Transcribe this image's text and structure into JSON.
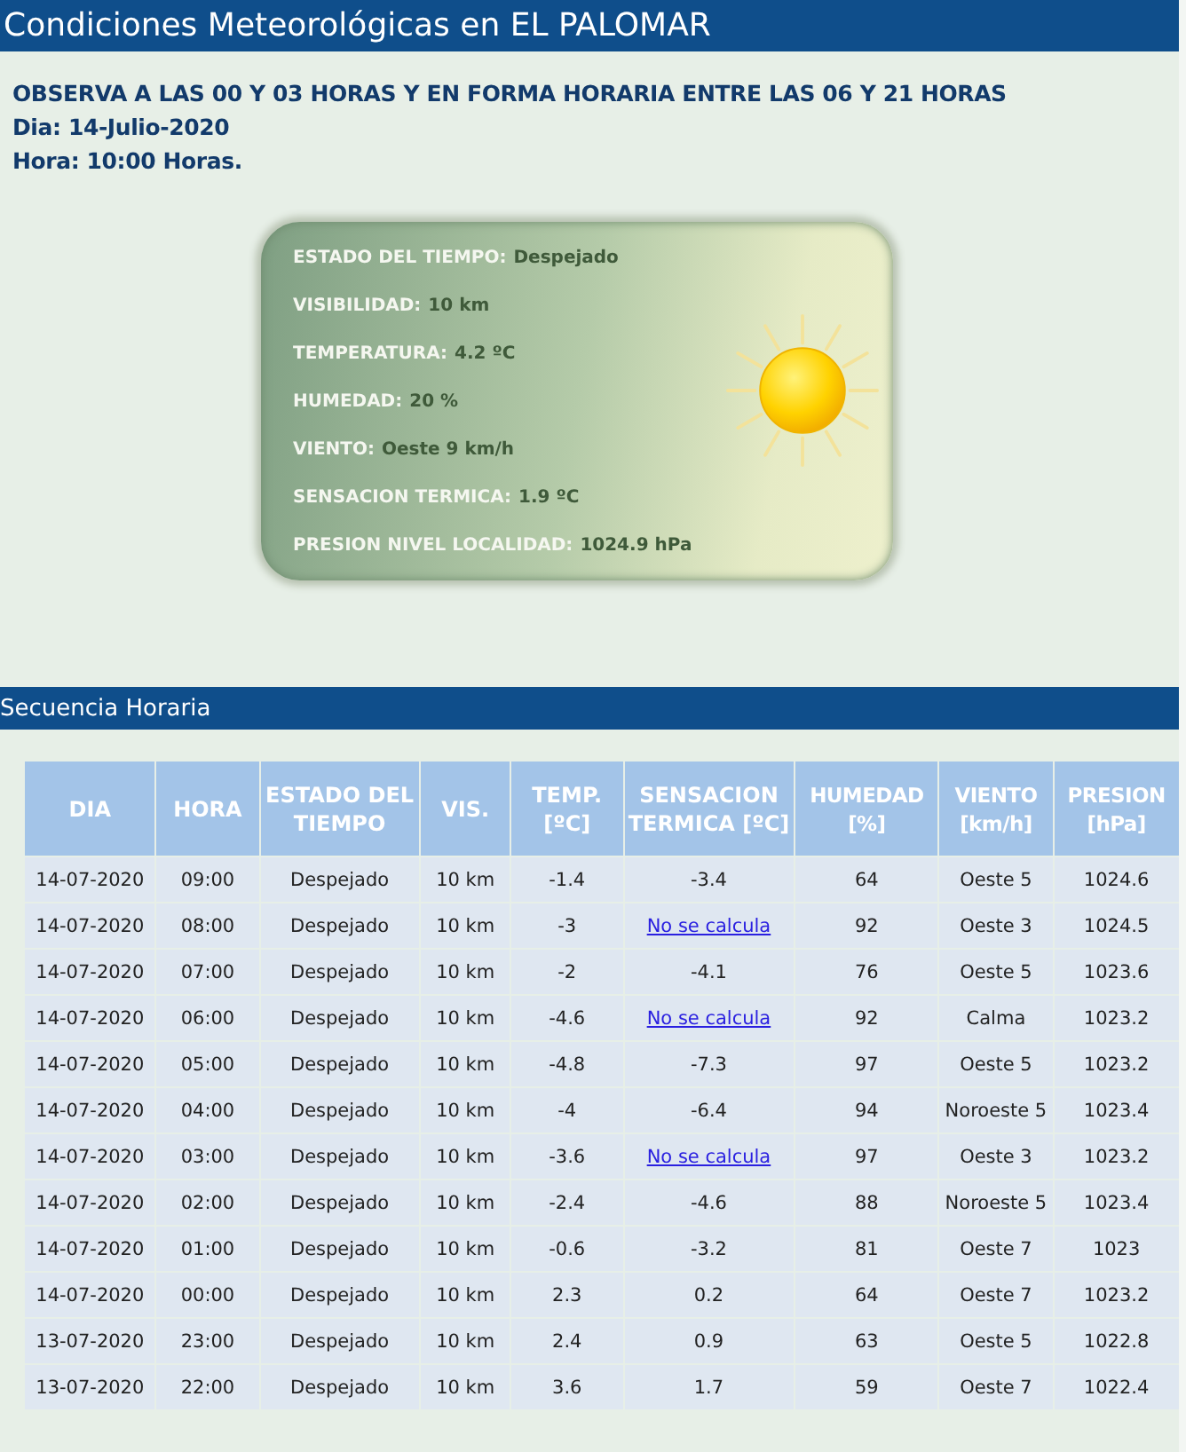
{
  "header": {
    "title": "Condiciones Meteorológicas en EL PALOMAR"
  },
  "info": [
    "OBSERVA A LAS 00 Y 03 HORAS Y EN FORMA HORARIA ENTRE LAS 06 Y 21 HORAS",
    "Dia: 14-Julio-2020",
    "Hora: 10:00 Horas."
  ],
  "current": {
    "fields": [
      {
        "label": "ESTADO DEL TIEMPO:",
        "value": "Despejado"
      },
      {
        "label": "VISIBILIDAD:",
        "value": "10 km"
      },
      {
        "label": "TEMPERATURA:",
        "value": "4.2 ºC"
      },
      {
        "label": "HUMEDAD:",
        "value": "20 %"
      },
      {
        "label": "VIENTO:",
        "value": "Oeste 9 km/h"
      },
      {
        "label": "SENSACION TERMICA:",
        "value": "1.9 ºC"
      },
      {
        "label": "PRESION NIVEL LOCALIDAD:",
        "value": "1024.9 hPa"
      }
    ]
  },
  "section": {
    "title": "Secuencia Horaria"
  },
  "table": {
    "columns": [
      "DIA",
      "HORA",
      "ESTADO DEL TIEMPO",
      "VIS.",
      "TEMP. [ºC]",
      "SENSACION TERMICA [ºC]",
      "HUMEDAD [%]",
      "VIENTO [km/h]",
      "PRESION [hPa]"
    ],
    "rows": [
      {
        "cells": [
          "14-07-2020",
          "09:00",
          "Despejado",
          "10 km",
          "-1.4",
          "-3.4",
          "64",
          "Oeste 5",
          "1024.6"
        ],
        "link_col": false
      },
      {
        "cells": [
          "14-07-2020",
          "08:00",
          "Despejado",
          "10 km",
          "-3",
          "No se calcula",
          "92",
          "Oeste 3",
          "1024.5"
        ],
        "link_col": true
      },
      {
        "cells": [
          "14-07-2020",
          "07:00",
          "Despejado",
          "10 km",
          "-2",
          "-4.1",
          "76",
          "Oeste 5",
          "1023.6"
        ],
        "link_col": false
      },
      {
        "cells": [
          "14-07-2020",
          "06:00",
          "Despejado",
          "10 km",
          "-4.6",
          "No se calcula",
          "92",
          "Calma",
          "1023.2"
        ],
        "link_col": true
      },
      {
        "cells": [
          "14-07-2020",
          "05:00",
          "Despejado",
          "10 km",
          "-4.8",
          "-7.3",
          "97",
          "Oeste 5",
          "1023.2"
        ],
        "link_col": false
      },
      {
        "cells": [
          "14-07-2020",
          "04:00",
          "Despejado",
          "10 km",
          "-4",
          "-6.4",
          "94",
          "Noroeste 5",
          "1023.4"
        ],
        "link_col": false
      },
      {
        "cells": [
          "14-07-2020",
          "03:00",
          "Despejado",
          "10 km",
          "-3.6",
          "No se calcula",
          "97",
          "Oeste 3",
          "1023.2"
        ],
        "link_col": true
      },
      {
        "cells": [
          "14-07-2020",
          "02:00",
          "Despejado",
          "10 km",
          "-2.4",
          "-4.6",
          "88",
          "Noroeste 5",
          "1023.4"
        ],
        "link_col": false
      },
      {
        "cells": [
          "14-07-2020",
          "01:00",
          "Despejado",
          "10 km",
          "-0.6",
          "-3.2",
          "81",
          "Oeste 7",
          "1023"
        ],
        "link_col": false
      },
      {
        "cells": [
          "14-07-2020",
          "00:00",
          "Despejado",
          "10 km",
          "2.3",
          "0.2",
          "64",
          "Oeste 7",
          "1023.2"
        ],
        "link_col": false
      },
      {
        "cells": [
          "13-07-2020",
          "23:00",
          "Despejado",
          "10 km",
          "2.4",
          "0.9",
          "63",
          "Oeste 5",
          "1022.8"
        ],
        "link_col": false
      },
      {
        "cells": [
          "13-07-2020",
          "22:00",
          "Despejado",
          "10 km",
          "3.6",
          "1.7",
          "59",
          "Oeste 7",
          "1022.4"
        ],
        "link_col": false
      }
    ]
  }
}
